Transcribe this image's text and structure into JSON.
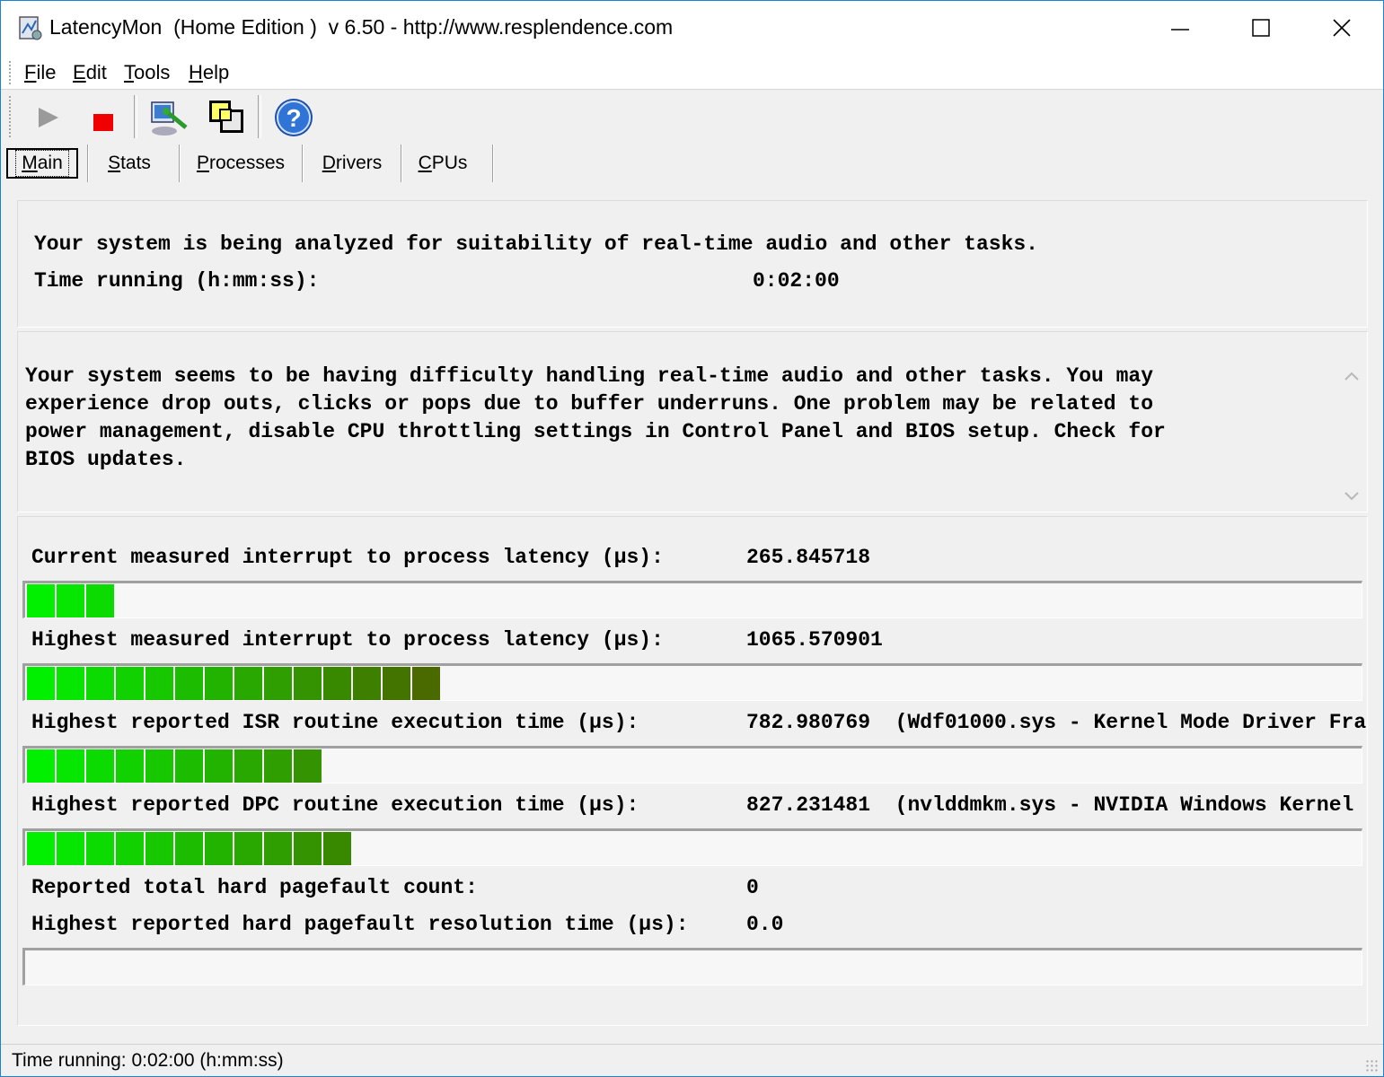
{
  "window": {
    "title": "LatencyMon  (Home Edition )  v 6.50 - http://www.resplendence.com"
  },
  "menu": {
    "items": [
      {
        "first": "F",
        "rest": "ile"
      },
      {
        "first": "E",
        "rest": "dit"
      },
      {
        "first": "T",
        "rest": "ools"
      },
      {
        "first": "H",
        "rest": "elp"
      }
    ]
  },
  "toolbar": {
    "icons": [
      "play-icon",
      "stop-icon",
      "analyze-icon",
      "windows-icon",
      "help-icon"
    ]
  },
  "tabs": [
    {
      "first": "M",
      "rest": "ain"
    },
    {
      "first": "S",
      "rest": "tats"
    },
    {
      "first": "P",
      "rest": "rocesses"
    },
    {
      "first": "D",
      "rest": "rivers"
    },
    {
      "first": "C",
      "rest": "PUs"
    }
  ],
  "status_panel": {
    "line1": "Your system is being analyzed for suitability of real-time audio and other tasks.",
    "time_label": "Time running (h:mm:ss):",
    "time_value": "0:02:00"
  },
  "message": {
    "lines": [
      "Your system seems to be having difficulty handling real-time audio and other tasks. You may",
      "experience drop outs, clicks or pops due to buffer underruns. One problem may be related to",
      "power management, disable CPU throttling settings in Control Panel and BIOS setup. Check for",
      "BIOS updates."
    ]
  },
  "metrics": [
    {
      "label": "Current measured interrupt to process latency (µs):",
      "value": "265.845718",
      "detail": "",
      "bar_segments": 3
    },
    {
      "label": "Highest measured interrupt to process latency (µs):",
      "value": "1065.570901",
      "detail": "",
      "bar_segments": 14
    },
    {
      "label": "Highest reported ISR routine execution time (µs):",
      "value": "782.980769",
      "detail": "(Wdf01000.sys - Kernel Mode Driver Fra",
      "bar_segments": 10
    },
    {
      "label": "Highest reported DPC routine execution time (µs):",
      "value": "827.231481",
      "detail": "(nvlddmkm.sys - NVIDIA Windows Kernel I",
      "bar_segments": 11
    }
  ],
  "pagefault": {
    "count_label": "Reported total hard pagefault count:",
    "count_value": "0",
    "resolution_label": "Highest reported hard pagefault resolution time (µs):",
    "resolution_value": "0.0",
    "bar_segments": 0
  },
  "statusbar": {
    "text": "Time running: 0:02:00  (h:mm:ss)"
  },
  "colors": {
    "bar_start": "#00f000",
    "bar_end": "#4a6a00",
    "accent_border": "#1883d7"
  }
}
